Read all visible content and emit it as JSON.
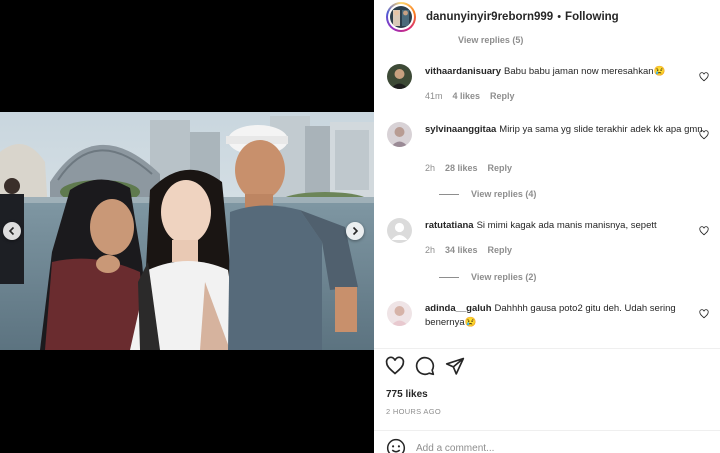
{
  "header": {
    "username": "danunyinyir9reborn999",
    "separator": "•",
    "follow_status": "Following"
  },
  "comments_panel": {
    "cut_off_reply_text": "View replies (5)",
    "comments": [
      {
        "username": "vithaardanisuary",
        "text": "Babu babu jaman now meresahkan😢",
        "time": "41m",
        "likes": "4 likes",
        "reply_label": "Reply",
        "view_replies": ""
      },
      {
        "username": "sylvinaanggitaa",
        "text": "Mirip ya sama yg slide terakhir adek kk apa gmn",
        "time": "2h",
        "likes": "28 likes",
        "reply_label": "Reply",
        "view_replies": "View replies (4)"
      },
      {
        "username": "ratutatiana",
        "text": "Si mimi kagak ada manis manisnya, sepett",
        "time": "2h",
        "likes": "34 likes",
        "reply_label": "Reply",
        "view_replies": "View replies (2)"
      },
      {
        "username": "adinda__galuh",
        "text": "Dahhhh gausa poto2 gitu deh. Udah sering benernya😢",
        "time": "",
        "likes": "",
        "reply_label": "",
        "view_replies": ""
      }
    ]
  },
  "actions": {
    "icons": [
      "heart-icon",
      "comment-icon",
      "share-icon"
    ]
  },
  "post": {
    "likes": "775 likes",
    "time_ago": "2 HOURS AGO"
  },
  "add_comment": {
    "placeholder": "Add a comment..."
  },
  "colors": {
    "text": "#262626",
    "secondary": "#8e8e8e",
    "story_ring": [
      "#feda75",
      "#fa7e1e",
      "#d62976",
      "#962fbf",
      "#4f5bd5"
    ]
  }
}
